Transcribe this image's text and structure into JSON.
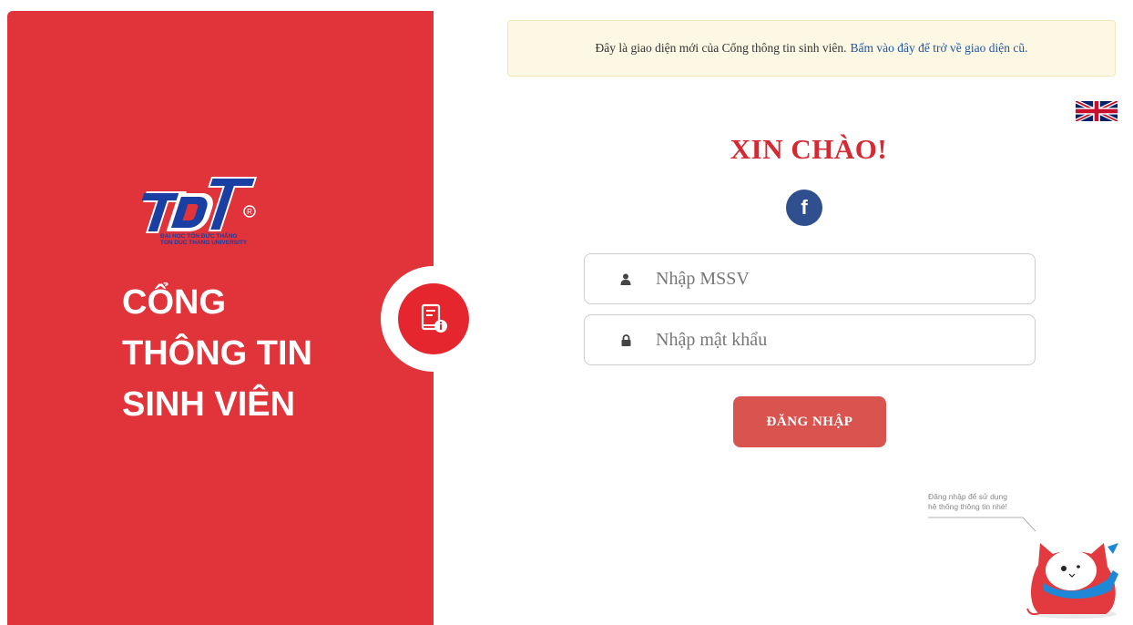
{
  "notice": {
    "text": "Đây là giao diện mới của Cổng thông tin sinh viên.",
    "link": "Bấm vào đây để trở về giao diện cũ."
  },
  "brand": {
    "logo_university_vn": "ĐẠI HỌC TÔN ĐỨC THẮNG",
    "logo_university_en": "TON DUC THANG UNIVERSITY",
    "title_lines": [
      "CỔNG",
      "THÔNG TIN",
      "SINH VIÊN"
    ]
  },
  "login": {
    "greeting": "XIN CHÀO!",
    "mssv_placeholder": "Nhập MSSV",
    "password_placeholder": "Nhập mật khẩu",
    "submit_label": "ĐĂNG NHẬP"
  },
  "mascot": {
    "hint_lines": [
      "Đăng nhập để sử dụng",
      "hệ thống thông tin nhé!"
    ]
  },
  "icons": {
    "user": "user-icon",
    "lock": "lock-icon",
    "facebook": "facebook-icon",
    "language": "uk-flag-icon",
    "portal_badge": "student-book-info-icon"
  },
  "colors": {
    "brand_red": "#e0333a",
    "greeting_red": "#d42a33",
    "button_red": "#d9534f",
    "facebook_blue": "#2f4f8f",
    "notice_bg": "#fcf8e3",
    "link_blue": "#1f56a6",
    "logo_blue": "#1a3fa3"
  }
}
